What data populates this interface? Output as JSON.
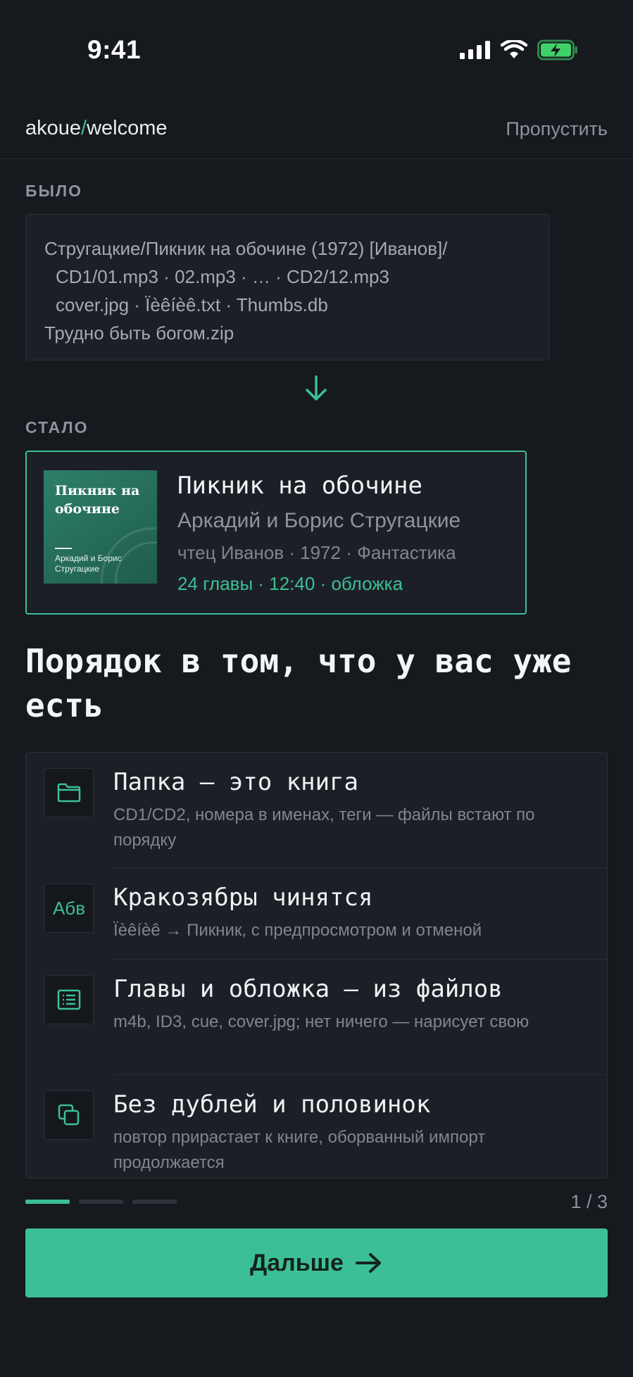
{
  "status_bar": {
    "time": "9:41"
  },
  "header": {
    "crumb_app": "akoue",
    "crumb_sep": "/",
    "crumb_page": "welcome",
    "skip_label": "Пропустить"
  },
  "before": {
    "label": "БЫЛО",
    "lines": [
      "Стругацкие/Пикник на обочине (1972) [Иванов]/",
      "CD1/01.mp3 · 02.mp3 · … · CD2/12.mp3",
      "cover.jpg · Ïèêíèê.txt · Thumbs.db",
      "Трудно быть богом.zip"
    ]
  },
  "after": {
    "label": "СТАЛО",
    "cover_title": "Пикник на обочине",
    "cover_author": "Аркадий и Борис Стругацкие",
    "title": "Пикник на обочине",
    "author": "Аркадий и Борис Стругацкие",
    "meta": "чтец Иванов · 1972 · Фантастика",
    "stats": "24 главы · 12:40 · обложка"
  },
  "headline": "Порядок в том, что у вас уже есть",
  "features": [
    {
      "icon": "folder-icon",
      "title": "Папка — это книга",
      "desc": "CD1/CD2, номера в именах, теги — файлы встают по порядку"
    },
    {
      "icon": "encoding-icon",
      "icon_text": "Абв",
      "title": "Кракозябры чинятся",
      "desc": "Ïèêíèê → Пикник, с предпросмотром и отменой"
    },
    {
      "icon": "chapters-list-icon",
      "title": "Главы и обложка — из файлов",
      "desc": "m4b, ID3, cue, cover.jpg; нет ничего — нарисует свою"
    },
    {
      "icon": "duplicates-icon",
      "title": "Без дублей и половинок",
      "desc": "повтор прирастает к книге, оборванный импорт продолжается"
    }
  ],
  "pager": {
    "current": 1,
    "total": 3,
    "count_text": "1 / 3"
  },
  "next_button": {
    "label": "Дальше"
  },
  "colors": {
    "accent": "#3cbf97",
    "background": "#16191e",
    "panel": "#1c2026"
  }
}
